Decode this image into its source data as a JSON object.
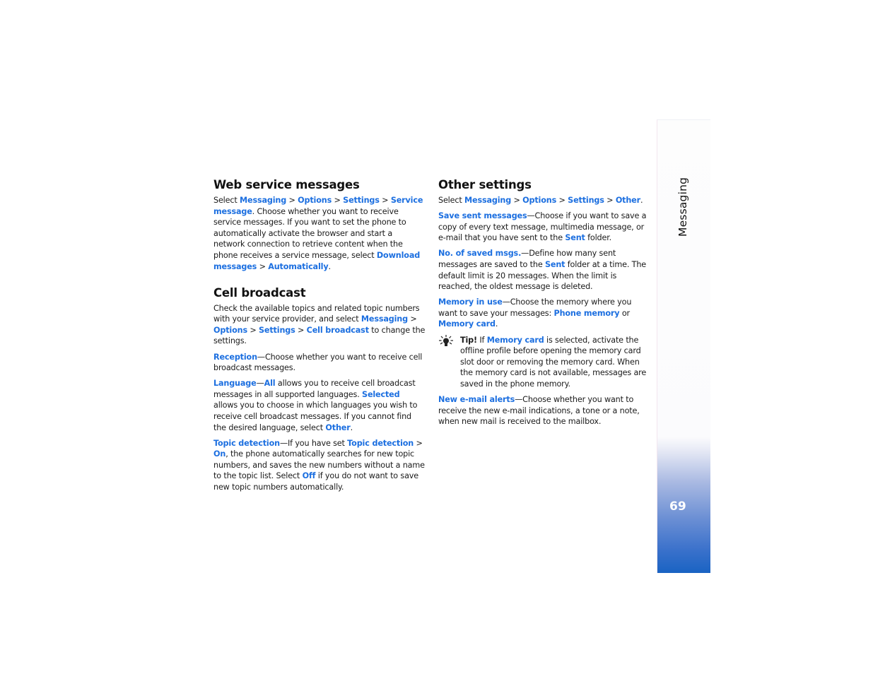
{
  "sidebar": {
    "section_label": "Messaging",
    "page_number": "69"
  },
  "left_column": {
    "web_service": {
      "heading": "Web service messages",
      "p1": {
        "t0": "Select ",
        "l1": "Messaging",
        "t1": " > ",
        "l2": "Options",
        "t2": " > ",
        "l3": "Settings",
        "t3": " > ",
        "l4": "Service message",
        "t4": ". Choose whether you want to receive service messages. If you want to set the phone to automatically activate the browser and start a network connection to retrieve content when the phone receives a service message, select ",
        "l5": "Download messages",
        "t5": " > ",
        "l6": "Automatically",
        "t6": "."
      }
    },
    "cell_broadcast": {
      "heading": "Cell broadcast",
      "p1": {
        "t0": "Check the available topics and related topic numbers with your service provider, and select ",
        "l1": "Messaging",
        "t1": " > ",
        "l2": "Options",
        "t2": " > ",
        "l3": "Settings",
        "t3": " > ",
        "l4": "Cell broadcast",
        "t4": " to change the settings."
      },
      "reception": {
        "l1": "Reception",
        "t1": "—Choose whether you want to receive cell broadcast messages."
      },
      "language": {
        "l1": "Language",
        "t1": "—",
        "l2": "All",
        "t2": " allows you to receive cell broadcast messages in all supported languages. ",
        "l3": "Selected",
        "t3": " allows you to choose in which languages you wish to receive cell broadcast messages. If you cannot find the desired language, select ",
        "l4": "Other",
        "t4": "."
      },
      "topic": {
        "l1": "Topic detection",
        "t1": "—If you have set ",
        "l2": "Topic detection",
        "t2": " > ",
        "l3": "On",
        "t3": ", the phone automatically searches for new topic numbers, and saves the new numbers without a name to the topic list. Select ",
        "l4": "Off",
        "t4": " if you do not want to save new topic numbers automatically."
      }
    }
  },
  "right_column": {
    "other_settings": {
      "heading": "Other settings",
      "p1": {
        "t0": "Select ",
        "l1": "Messaging",
        "t1": " > ",
        "l2": "Options",
        "t2": " > ",
        "l3": "Settings",
        "t3": " > ",
        "l4": "Other",
        "t4": "."
      },
      "save_sent": {
        "l1": "Save sent messages",
        "t1": "—Choose if you want to save a copy of every text message, multimedia message, or e-mail that you have sent to the ",
        "l2": "Sent",
        "t2": " folder."
      },
      "saved_msgs": {
        "l1": "No. of saved msgs.",
        "t1": "—Define how many sent messages are saved to the ",
        "l2": "Sent",
        "t2": " folder at a time. The default limit is 20 messages. When the limit is reached, the oldest message is deleted."
      },
      "memory": {
        "l1": "Memory in use",
        "t1": "—Choose the memory where you want to save your messages: ",
        "l2": "Phone memory",
        "t2": " or ",
        "l3": "Memory card",
        "t3": "."
      },
      "tip": {
        "label": "Tip!",
        "t0": " If ",
        "l1": "Memory card",
        "t1": " is selected, activate the offline profile before opening the memory card slot door or removing the memory card. When the memory card is not available, messages are saved in the phone memory."
      },
      "email_alerts": {
        "l1": "New e-mail alerts",
        "t1": "—Choose whether you want to receive the new e-mail indications, a tone or a note, when new mail is received to the mailbox."
      }
    }
  }
}
